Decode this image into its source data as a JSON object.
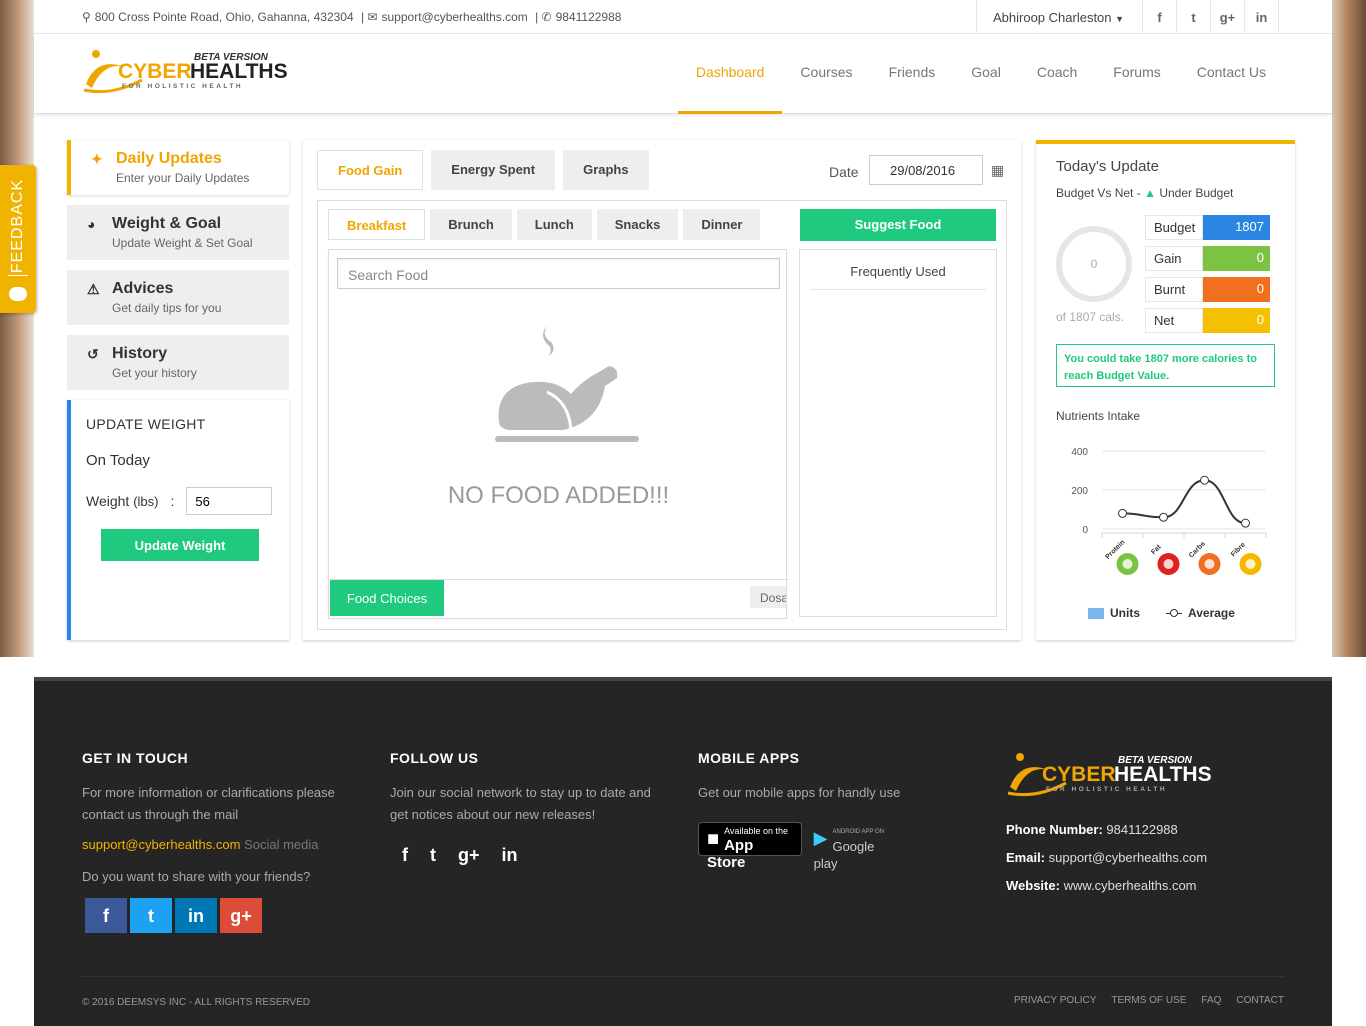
{
  "topbar": {
    "address": "800 Cross Pointe Road, Ohio, Gahanna, 432304",
    "email": "support@cyberhealths.com",
    "phone": "9841122988",
    "user_name": "Abhiroop Charleston",
    "social": [
      "f",
      "t",
      "g+",
      "in"
    ]
  },
  "logo": {
    "beta": "BETA VERSION",
    "name_a": "CYBER",
    "name_b": "HEALTHS",
    "tagline": "FOR HOLISTIC HEALTH"
  },
  "nav": [
    "Dashboard",
    "Courses",
    "Friends",
    "Goal",
    "Coach",
    "Forums",
    "Contact Us"
  ],
  "sidebar": {
    "items": [
      {
        "title": "Daily Updates",
        "sub": "Enter your Daily Updates",
        "icon": "runner-icon"
      },
      {
        "title": "Weight & Goal",
        "sub": "Update Weight & Set Goal",
        "icon": "gauge-icon"
      },
      {
        "title": "Advices",
        "sub": "Get daily tips for you",
        "icon": "warning-icon"
      },
      {
        "title": "History",
        "sub": "Get your history",
        "icon": "history-icon"
      }
    ],
    "update_weight": {
      "heading": "UPDATE WEIGHT",
      "on_today": "On Today",
      "weight_label": "Weight",
      "unit": "(lbs)",
      "colon": ":",
      "weight_value": "56",
      "button": "Update Weight"
    }
  },
  "main": {
    "tabs": [
      "Food Gain",
      "Energy Spent",
      "Graphs"
    ],
    "date_label": "Date",
    "date_value": "29/08/2016",
    "meal_tabs": [
      "Breakfast",
      "Brunch",
      "Lunch",
      "Snacks",
      "Dinner"
    ],
    "suggest_button": "Suggest Food",
    "search_placeholder": "Search Food",
    "empty_text": "NO FOOD ADDED!!!",
    "food_choices": "Food Choices",
    "dosa": "Dosa",
    "frequently_used": "Frequently Used"
  },
  "today": {
    "title": "Today's Update",
    "budget_vs_net": "Budget Vs Net",
    "dash": "-",
    "status": "Under Budget",
    "ring_value": "0",
    "of_cals": "of 1807 cals.",
    "rows": [
      {
        "label": "Budget",
        "value": "1807",
        "color": "#2b86e3"
      },
      {
        "label": "Gain",
        "value": "0",
        "color": "#7cc243"
      },
      {
        "label": "Burnt",
        "value": "0",
        "color": "#f07020"
      },
      {
        "label": "Net",
        "value": "0",
        "color": "#f5c000"
      }
    ],
    "message": "You could take 1807 more calories to reach Budget Value.",
    "nutrients_title": "Nutrients Intake",
    "legend_units": "Units",
    "legend_average": "Average"
  },
  "chart_data": {
    "type": "line",
    "categories": [
      "Protein",
      "Fat",
      "Carbs",
      "Fibre"
    ],
    "series": [
      {
        "name": "Units",
        "values": [
          0,
          0,
          0,
          0
        ]
      },
      {
        "name": "Average",
        "values": [
          80,
          60,
          250,
          30
        ]
      }
    ],
    "yticks": [
      "400",
      "200",
      "0"
    ],
    "ylim": [
      0,
      400
    ],
    "category_colors": [
      "#7cc243",
      "#e02020",
      "#f07020",
      "#f5b800"
    ]
  },
  "feedback": "FEEDBACK",
  "footer": {
    "touch": {
      "title": "GET IN TOUCH",
      "text": "For more information or clarifications please contact us through the mail",
      "email": "support@cyberhealths.com",
      "social_media": "Social media",
      "share": "Do you want to share with your friends?"
    },
    "follow": {
      "title": "FOLLOW US",
      "text": "Join our social network to stay up to date and get notices about our new releases!"
    },
    "apps": {
      "title": "MOBILE APPS",
      "text": "Get our mobile apps for handly use",
      "appstore_small": "Available on the",
      "appstore_big": "App Store",
      "gplay_small": "ANDROID APP ON",
      "gplay_big": "Google play"
    },
    "contact": {
      "phone_label": "Phone Number:",
      "phone": "9841122988",
      "email_label": "Email:",
      "email": "support@cyberhealths.com",
      "website_label": "Website:",
      "website": "www.cyberhealths.com"
    },
    "copyright": "© 2016 DEEMSYS INC - ALL RIGHTS RESERVED",
    "links": [
      "PRIVACY POLICY",
      "TERMS OF USE",
      "FAQ",
      "CONTACT"
    ]
  }
}
